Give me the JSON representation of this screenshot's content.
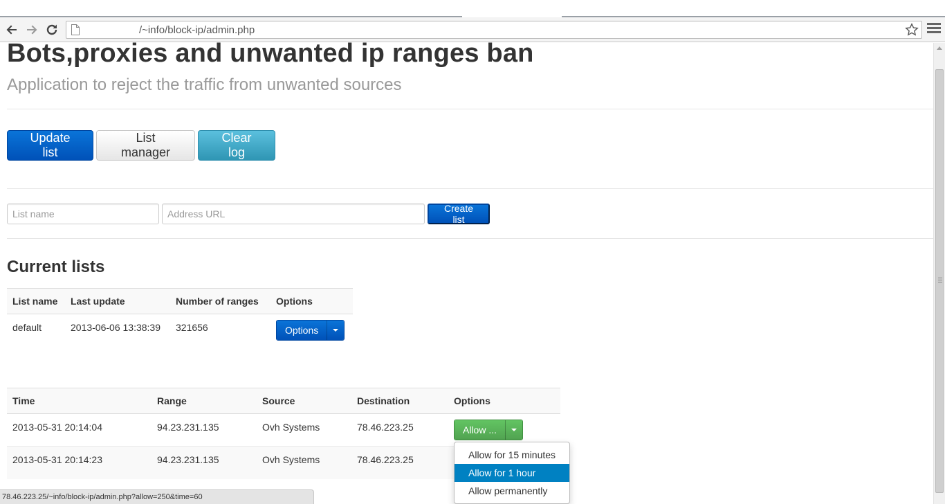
{
  "browser": {
    "url": "/~info/block-ip/admin.php",
    "status_url": "78.46.223.25/~info/block-ip/admin.php?allow=250&time=60"
  },
  "header": {
    "title": "Bots,proxies and unwanted ip ranges ban",
    "subtitle": "Application to reject the traffic from unwanted sources"
  },
  "actions": {
    "update_list": "Update list",
    "list_manager": "List manager",
    "clear_log": "Clear log"
  },
  "create_form": {
    "list_name_placeholder": "List name",
    "address_url_placeholder": "Address URL",
    "create_button": "Create list"
  },
  "current_lists": {
    "heading": "Current lists",
    "columns": [
      "List name",
      "Last update",
      "Number of ranges",
      "Options"
    ],
    "rows": [
      {
        "name": "default",
        "last_update": "2013-06-06 13:38:39",
        "ranges": "321656",
        "options_label": "Options"
      }
    ]
  },
  "log": {
    "columns": [
      "Time",
      "Range",
      "Source",
      "Destination",
      "Options"
    ],
    "rows": [
      {
        "time": "2013-05-31 20:14:04",
        "range": "94.23.231.135",
        "source": "Ovh Systems",
        "destination": "78.46.223.25",
        "action_label": "Allow ..."
      },
      {
        "time": "2013-05-31 20:14:23",
        "range": "94.23.231.135",
        "source": "Ovh Systems",
        "destination": "78.46.223.25"
      }
    ]
  },
  "allow_menu": {
    "items": [
      "Allow for 15 minutes",
      "Allow for 1 hour",
      "Allow permanently"
    ],
    "active_index": 1
  },
  "colors": {
    "primary": "#0051b8",
    "info": "#2f96b4",
    "success": "#51a351",
    "menu_active": "#0081c2"
  }
}
